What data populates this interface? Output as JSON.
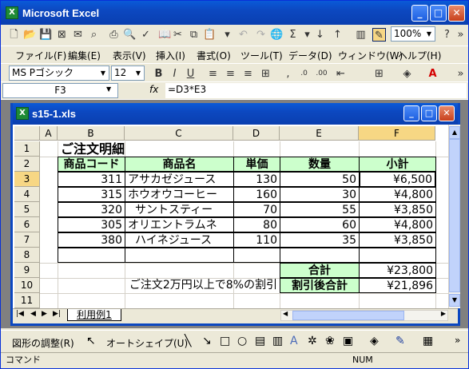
{
  "app": {
    "title": "Microsoft Excel"
  },
  "toolbar": {
    "zoom": "100%",
    "help": "?"
  },
  "menu": [
    "ファイル(F)",
    "編集(E)",
    "表示(V)",
    "挿入(I)",
    "書式(O)",
    "ツール(T)",
    "データ(D)",
    "ウィンドウ(W)",
    "ヘルプ(H)"
  ],
  "format": {
    "font": "MS Pゴシック",
    "size": "12"
  },
  "formula_bar": {
    "name_box": "F3",
    "fx": "fx",
    "formula": "=D3*E3"
  },
  "workbook": {
    "title": "s15-1.xls",
    "sheet_tab": "利用例1"
  },
  "columns": [
    "A",
    "B",
    "C",
    "D",
    "E",
    "F"
  ],
  "rows": [
    "1",
    "2",
    "3",
    "4",
    "5",
    "6",
    "7",
    "8",
    "9",
    "10",
    "11"
  ],
  "sheet": {
    "title": "ご注文明細",
    "headers": [
      "商品コード",
      "商品名",
      "単価",
      "数量",
      "小計"
    ],
    "items": [
      {
        "code": "311",
        "name": "アサカゼジュース",
        "price": "130",
        "qty": "50",
        "subtotal": "¥6,500"
      },
      {
        "code": "315",
        "name": "ホウオウコーヒー",
        "price": "160",
        "qty": "30",
        "subtotal": "¥4,800"
      },
      {
        "code": "320",
        "name": "サントスティー",
        "price": "70",
        "qty": "55",
        "subtotal": "¥3,850"
      },
      {
        "code": "305",
        "name": "オリエントラムネ",
        "price": "80",
        "qty": "60",
        "subtotal": "¥4,800"
      },
      {
        "code": "380",
        "name": "ハイネジュース",
        "price": "110",
        "qty": "35",
        "subtotal": "¥3,850"
      }
    ],
    "total_label": "合計",
    "total": "¥23,800",
    "note": "ご注文2万円以上で8%の割引",
    "discount_label": "割引後合計",
    "discount_total": "¥21,896"
  },
  "drawing": {
    "adjust": "図形の調整(R)",
    "autoshape": "オートシェイプ(U)"
  },
  "status": {
    "mode": "コマンド",
    "num": "NUM"
  },
  "colors": {
    "header_fill": "#ccffcc",
    "active_header": "#f7d784",
    "title_blue": "#0c48c0"
  }
}
